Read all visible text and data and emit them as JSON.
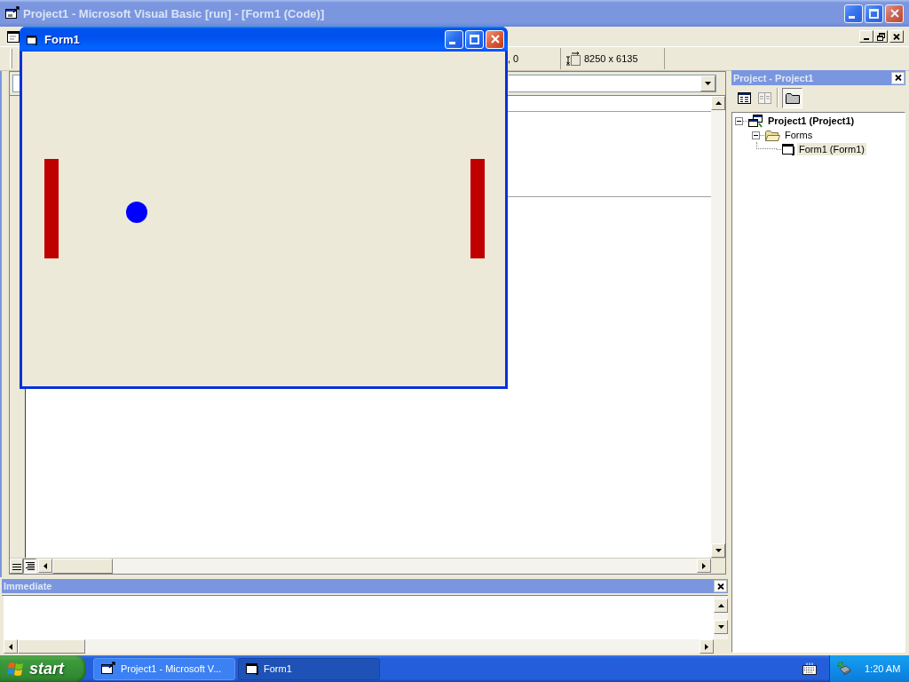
{
  "ide_window": {
    "title": "Project1 - Microsoft Visual Basic [run] - [Form1 (Code)]",
    "active": false
  },
  "toolbar": {
    "position": ", 0",
    "size": "8250 x 6135"
  },
  "project_panel": {
    "title": "Project - Project1",
    "tree": [
      {
        "kind": "project",
        "label": "Project1 (Project1)",
        "expanded": true,
        "selected": false,
        "children": [
          {
            "kind": "folder",
            "label": "Forms",
            "expanded": true,
            "selected": false,
            "children": [
              {
                "kind": "form",
                "label": "Form1 (Form1)",
                "selected": true
              }
            ]
          }
        ]
      }
    ]
  },
  "immediate": {
    "title": "Immediate"
  },
  "form_window": {
    "title": "Form1",
    "active": true
  },
  "taskbar": {
    "start": "start",
    "buttons": [
      {
        "kind": "program",
        "label": "Project1 - Microsoft V...",
        "selected": false
      },
      {
        "kind": "form",
        "label": "Form1",
        "selected": true
      }
    ],
    "clock": "1:20 AM"
  }
}
